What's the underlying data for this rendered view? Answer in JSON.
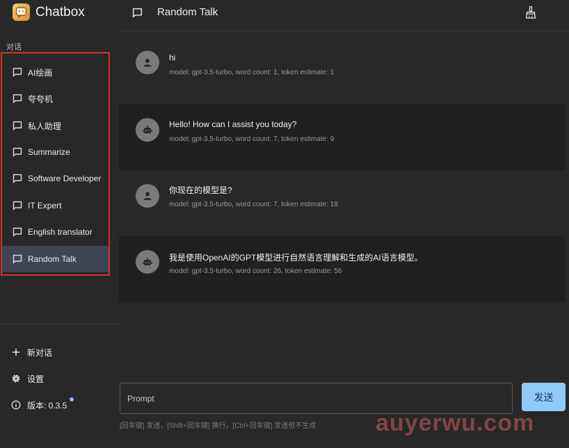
{
  "app": {
    "title": "Chatbox"
  },
  "sidebar": {
    "section_label": "对话",
    "items": [
      {
        "label": "AI绘画"
      },
      {
        "label": "夸夸机"
      },
      {
        "label": "私人助理"
      },
      {
        "label": "Summarize"
      },
      {
        "label": "Software Developer"
      },
      {
        "label": "IT Expert"
      },
      {
        "label": "English translator"
      },
      {
        "label": "Random Talk",
        "active": true
      }
    ],
    "actions": {
      "new_chat": "新对话",
      "settings": "设置",
      "version": "版本: 0.3.5"
    }
  },
  "header": {
    "title": "Random Talk"
  },
  "messages": [
    {
      "role": "user",
      "text": "hi",
      "meta": "model: gpt-3.5-turbo, word count: 1, token estimate: 1"
    },
    {
      "role": "assistant",
      "text": "Hello! How can I assist you today?",
      "meta": "model: gpt-3.5-turbo, word count: 7, token estimate: 9"
    },
    {
      "role": "user",
      "text": "你现在的模型是?",
      "meta": "model: gpt-3.5-turbo, word count: 7, token estimate: 18"
    },
    {
      "role": "assistant",
      "text": "我是使用OpenAI的GPT模型进行自然语言理解和生成的AI语言模型。",
      "meta": "model: gpt-3.5-turbo, word count: 26, token estimate: 56"
    }
  ],
  "input": {
    "placeholder": "Prompt",
    "send_label": "发送",
    "hint": "[回车键] 发送，[Shift+回车键] 换行，[Ctrl+回车键] 发送但不生成"
  },
  "watermark": "auyerwu.com",
  "colors": {
    "background": "#282828",
    "assistant_row": "#202020",
    "active_item": "#3e4552",
    "highlight_border": "#d9302c",
    "send_button": "#90caf9",
    "update_dot": "#8ab4f8"
  },
  "icons": {
    "conversation": "chat-bubble-icon",
    "new_chat": "plus-icon",
    "settings": "gear-icon",
    "version": "info-icon",
    "clean": "broom-icon",
    "user_avatar": "person-icon",
    "assistant_avatar": "robot-icon"
  }
}
